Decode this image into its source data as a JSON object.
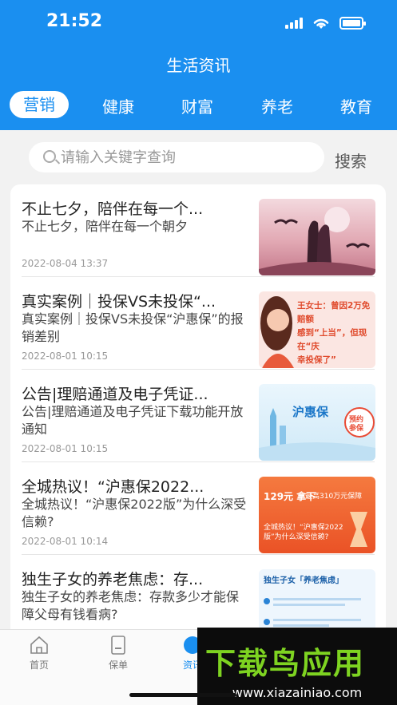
{
  "status_bar": {
    "time": "21:52"
  },
  "header": {
    "title": "生活资讯"
  },
  "tabs": [
    {
      "label": "营销",
      "active": true
    },
    {
      "label": "健康",
      "active": false
    },
    {
      "label": "财富",
      "active": false
    },
    {
      "label": "养老",
      "active": false
    },
    {
      "label": "教育",
      "active": false
    }
  ],
  "search": {
    "placeholder": "请输入关键字查询",
    "value": "",
    "button_label": "搜索"
  },
  "articles": [
    {
      "title": "不止七夕，陪伴在每一个...",
      "summary": "不止七夕，陪伴在每一个朝夕",
      "time": "2022-08-04 13:37"
    },
    {
      "title": "真实案例｜投保VS未投保“...",
      "summary": "真实案例｜投保VS未投保“沪惠保”的报销差别",
      "time": "2022-08-01 10:15",
      "thumb_text": [
        "王女士：曾因2万免赔额",
        "感到“上当”，但现在“庆",
        "幸投保了”"
      ]
    },
    {
      "title": "公告|理赔通道及电子凭证...",
      "summary": "公告|理赔通道及电子凭证下载功能开放通知",
      "time": "2022-08-01 10:15",
      "thumb_text": [
        "沪惠保",
        "预约参保"
      ]
    },
    {
      "title": "全城热议！“沪惠保2022...",
      "summary": "全城热议！“沪惠保2022版”为什么深受信赖?",
      "time": "2022-08-01 10:14",
      "thumb_text": [
        "129元 拿下",
        "最高310万元保障",
        "全城热议！“沪惠保2022版”为什么深受信赖?"
      ]
    },
    {
      "title": "独生子女的养老焦虑：存...",
      "summary": "独生子女的养老焦虑：存款多少才能保障父母有钱看病?",
      "time": "",
      "thumb_text": [
        "独生子女「养老焦虑」"
      ]
    }
  ],
  "tabbar": [
    {
      "label": "首页",
      "icon": "home-icon"
    },
    {
      "label": "保单",
      "icon": "policy-icon"
    },
    {
      "label": "资讯",
      "icon": "news-icon"
    }
  ],
  "watermark": {
    "main": "下载鸟应用",
    "url": "www.xiazainiao.com"
  },
  "colors": {
    "primary": "#1a8ff0",
    "watermark_green": "#7ed321"
  }
}
